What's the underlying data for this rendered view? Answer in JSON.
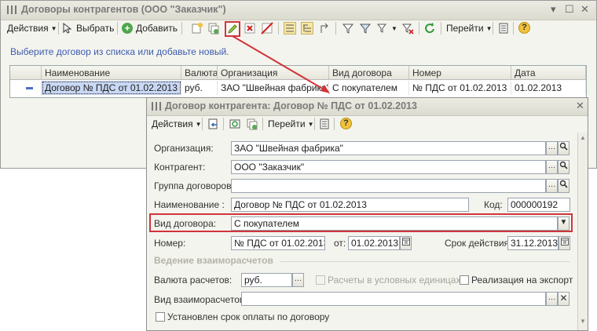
{
  "main_window": {
    "title": "Договоры контрагентов (ООО \"Заказчик\")",
    "toolbar": {
      "actions_label": "Действия",
      "select_label": "Выбрать",
      "add_label": "Добавить",
      "goto_label": "Перейти"
    },
    "hint": "Выберите договор из списка или добавьте новый.",
    "table": {
      "columns": [
        "Наименование",
        "Валюта",
        "Организация",
        "Вид договора",
        "Номер",
        "Дата"
      ],
      "rows": [
        [
          "Договор № ПДС от 01.02.2013",
          "руб.",
          "ЗАО \"Швейная фабрика\"",
          "С покупателем",
          "№ ПДС от 01.02.2013",
          "01.02.2013"
        ]
      ]
    }
  },
  "form_window": {
    "title": "Договор контрагента: Договор № ПДС от 01.02.2013",
    "toolbar": {
      "actions_label": "Действия",
      "goto_label": "Перейти"
    },
    "fields": {
      "organization_label": "Организация:",
      "organization_value": "ЗАО \"Швейная фабрика\"",
      "counterparty_label": "Контрагент:",
      "counterparty_value": "ООО \"Заказчик\"",
      "group_label": "Группа договоров:",
      "group_value": "",
      "name_label": "Наименование :",
      "name_value": "Договор № ПДС от 01.02.2013",
      "code_label": "Код:",
      "code_value": "000000192",
      "type_label": "Вид договора:",
      "type_value": "С покупателем",
      "number_label": "Номер:",
      "number_value": "№ ПДС от 01.02.2013",
      "from_label": "от:",
      "from_value": "01.02.2013",
      "term_label": "Срок действия:",
      "term_value": "31.12.2013"
    },
    "settlements": {
      "section_title": "Ведение взаиморасчетов",
      "currency_label": "Валюта расчетов:",
      "currency_value": "руб.",
      "conventional_units_label": "Расчеты в условных единицах",
      "export_label": "Реализация на экспорт",
      "settlement_type_label": "Вид взаиморасчетов:",
      "settlement_type_value": "",
      "payment_term_label": "Установлен срок оплаты по договору"
    }
  },
  "colors": {
    "highlight": "#d0343a",
    "selection": "#c9d8f4",
    "hint_text": "#3a5bb0"
  }
}
